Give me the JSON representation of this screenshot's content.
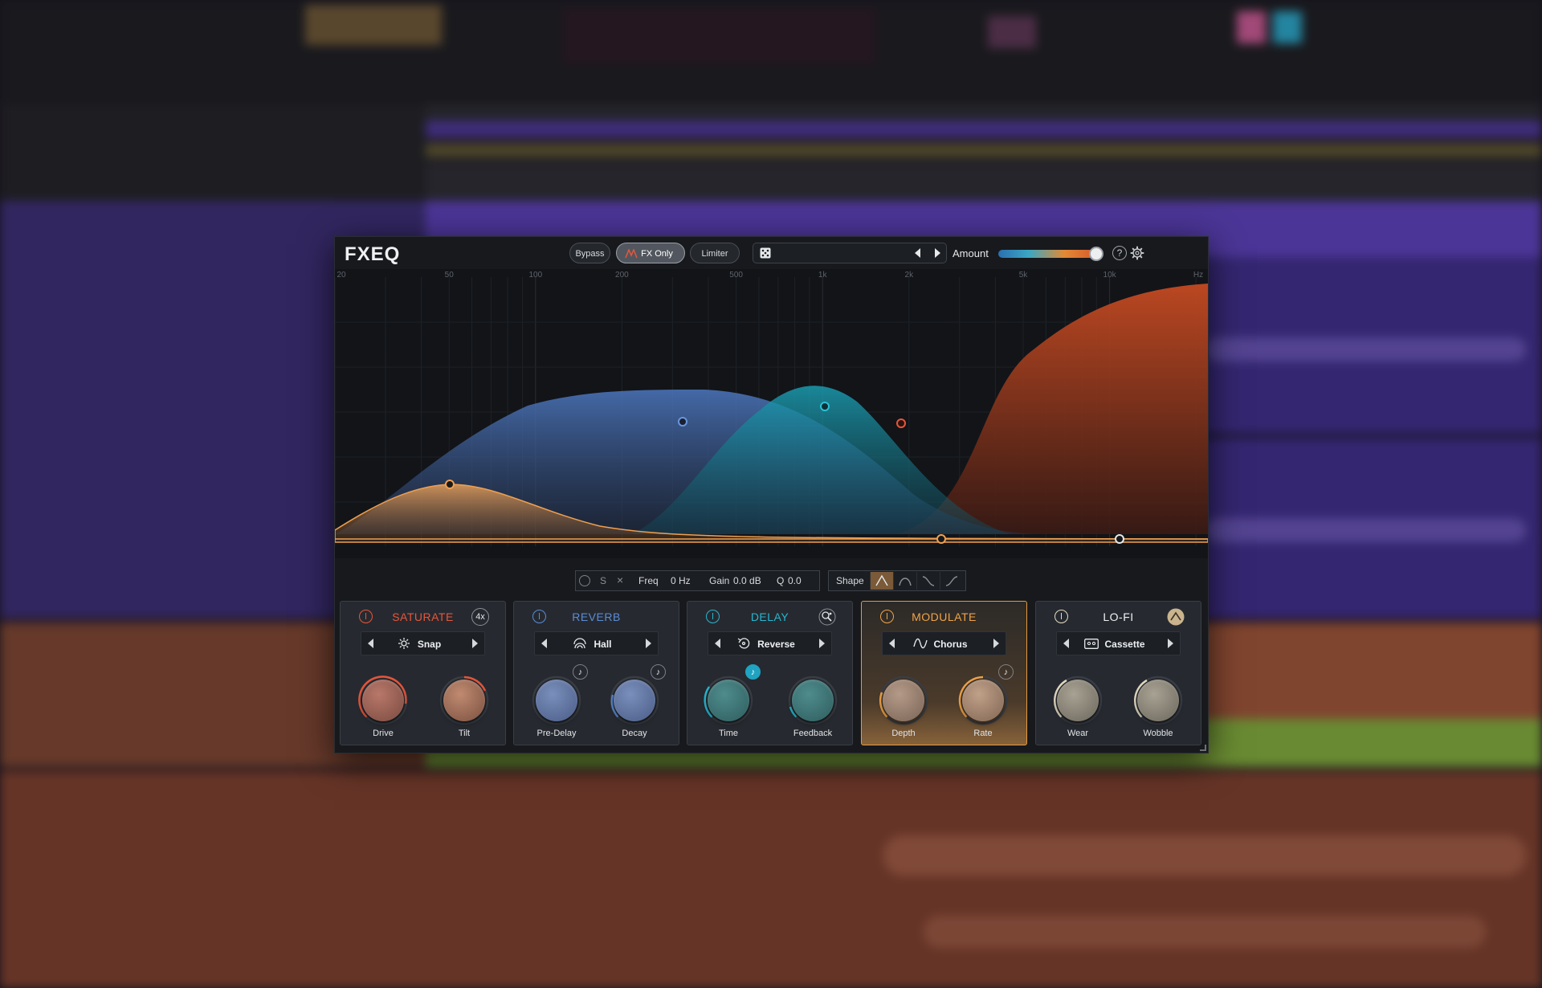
{
  "app": {
    "title": "FXEQ"
  },
  "header": {
    "bypass_label": "Bypass",
    "fx_only_label": "FX Only",
    "limiter_label": "Limiter",
    "amount_label": "Amount",
    "amount_value": 0.97,
    "help_icon": "?",
    "settings_icon": "gear-icon"
  },
  "eq": {
    "freq_labels": [
      "20",
      "50",
      "100",
      "200",
      "500",
      "1k",
      "2k",
      "5k",
      "10k",
      "Hz"
    ]
  },
  "band": {
    "solo_label": "S",
    "freq_label": "Freq",
    "freq_value": "0 Hz",
    "gain_label": "Gain",
    "gain_value": "0.0 dB",
    "q_label": "Q",
    "q_value": "0.0"
  },
  "shape": {
    "label": "Shape",
    "selected": 0
  },
  "modules": [
    {
      "title": "SATURATE",
      "color": "#e8553a",
      "option": "4x",
      "preset": "Snap",
      "knobs": [
        {
          "label": "Drive",
          "value": 0.55
        },
        {
          "label": "Tilt",
          "value": 0.7
        }
      ]
    },
    {
      "title": "REVERB",
      "color": "#5b8bd6",
      "preset": "Hall",
      "knobs": [
        {
          "label": "Pre-Delay",
          "value": 0.0
        },
        {
          "label": "Decay",
          "value": 0.3
        }
      ]
    },
    {
      "title": "DELAY",
      "color": "#26b6cf",
      "preset": "Reverse",
      "knobs": [
        {
          "label": "Time",
          "value": 0.35
        },
        {
          "label": "Feedback",
          "value": 0.1
        }
      ]
    },
    {
      "title": "MODULATE",
      "color": "#f0a348",
      "preset": "Chorus",
      "active": true,
      "knobs": [
        {
          "label": "Depth",
          "value": 0.3
        },
        {
          "label": "Rate",
          "value": 0.5
        }
      ]
    },
    {
      "title": "LO-FI",
      "color": "#e7dcc4",
      "preset": "Cassette",
      "knobs": [
        {
          "label": "Wear",
          "value": 0.4
        },
        {
          "label": "Wobble",
          "value": 0.4
        }
      ]
    }
  ]
}
